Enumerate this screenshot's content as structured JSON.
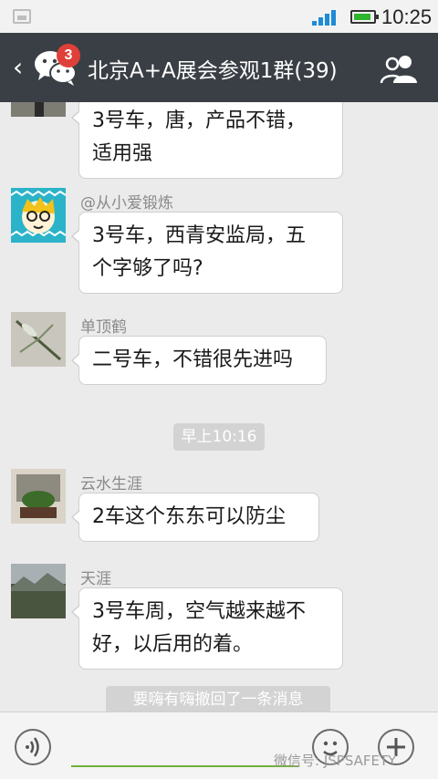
{
  "status_bar": {
    "time": "10:25",
    "icons": [
      "image-notification-icon",
      "signal-icon",
      "battery-icon"
    ]
  },
  "header": {
    "back_icon": "‹",
    "badge_count": "3",
    "title": "北京A+A展会参观1群(39)",
    "icons": [
      "back-icon",
      "wechat-icon",
      "group-members-icon"
    ]
  },
  "messages": [
    {
      "sender": "",
      "lines": [
        "3号车，唐，产品不错，",
        "适用强"
      ]
    },
    {
      "sender": "@从小爱锻炼",
      "lines": [
        "3号车，西青安监局，五",
        "个字够了吗?"
      ]
    },
    {
      "sender": "单顶鹤",
      "lines": [
        "二号车，不错很先进吗"
      ]
    },
    {
      "sender": "云水生涯",
      "lines": [
        "2车这个东东可以防尘"
      ]
    },
    {
      "sender": "天涯",
      "lines": [
        "3号车周，空气越来越不",
        "好，以后用的着。"
      ]
    }
  ],
  "timestamp": "早上10:16",
  "system_notice": "要嗨有嗨撤回了一条消息",
  "input_bar": {
    "placeholder": "",
    "watermark": "微信号: JSPSAFETY",
    "icons": [
      "voice-icon",
      "emoji-icon",
      "plus-icon"
    ]
  },
  "colors": {
    "header_bg": "#3a3f45",
    "badge": "#e0403a",
    "chat_bg": "#ebebeb",
    "input_underline": "#6fb23a"
  }
}
